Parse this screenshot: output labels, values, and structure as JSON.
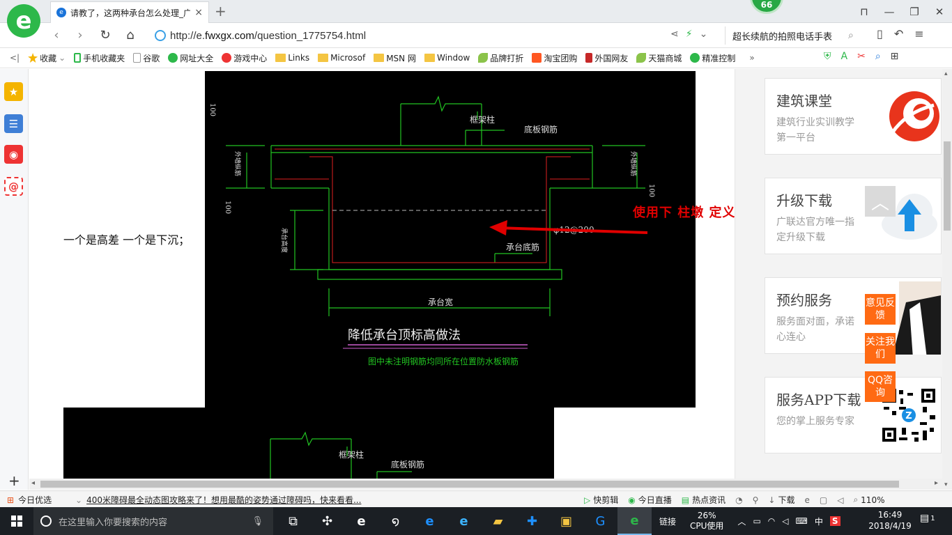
{
  "browser": {
    "tab_title": "请教了，这两种承台怎么处理_广",
    "tab_close": "×",
    "new_tab": "+",
    "badge_count": "66",
    "logo_letter": "e"
  },
  "address": {
    "url_prefix": "http://e.",
    "url_domain": "fwxgx.com",
    "url_suffix": "/question_1775754.html",
    "search_text": "超长续航的拍照电话手表"
  },
  "bookmarks": [
    {
      "label": "收藏",
      "icon": "star-icon",
      "color": "#f4b400"
    },
    {
      "label": "手机收藏夹",
      "icon": "phone-icon",
      "color": "#2db84a"
    },
    {
      "label": "谷歌",
      "icon": "page-icon",
      "color": "#999999"
    },
    {
      "label": "网址大全",
      "icon": "globe-icon",
      "color": "#2db84a"
    },
    {
      "label": "游戏中心",
      "icon": "game-icon",
      "color": "#e33"
    },
    {
      "label": "Links",
      "icon": "folder-icon",
      "color": "#f4c542"
    },
    {
      "label": "Microsof",
      "icon": "folder-icon",
      "color": "#f4c542"
    },
    {
      "label": "MSN 网",
      "icon": "folder-icon",
      "color": "#f4c542"
    },
    {
      "label": "Window",
      "icon": "folder-icon",
      "color": "#f4c542"
    },
    {
      "label": "品牌打折",
      "icon": "leaf-icon",
      "color": "#8bc34a"
    },
    {
      "label": "淘宝团购",
      "icon": "taobao-icon",
      "color": "#ff5722"
    },
    {
      "label": "外国网友",
      "icon": "flag-icon",
      "color": "#c62828"
    },
    {
      "label": "天猫商城",
      "icon": "leaf-icon",
      "color": "#8bc34a"
    },
    {
      "label": "精准控制",
      "icon": "chat-icon",
      "color": "#2db84a"
    }
  ],
  "bookmarks_more": "»",
  "content": {
    "left_caption": "一个是高差 一个是下沉；",
    "red_annotation": "使用下 柱墩 定义",
    "cad": {
      "frame_col_label": "框架柱",
      "bottom_rebar_label": "底板钢筋",
      "pile_cap_bottom_label": "承台底筋",
      "pile_cap_width_label": "承台宽",
      "side_rebar_left": "外墙纵筋",
      "side_rebar_right": "外墙纵筋",
      "height_label": "承台高度",
      "rebar_spec": "φ12@200",
      "dim_100_a": "100",
      "dim_100_b": "100",
      "dim_100_c": "100",
      "drawing_title": "降低承台顶标高做法",
      "drawing_note": "图中未注明钢筋均同所在位置防水板钢筋",
      "frame_col_label_2": "框架柱",
      "bottom_rebar_label_2": "底板钢筋"
    }
  },
  "rightcol": {
    "cards": [
      {
        "title": "建筑课堂",
        "sub": "建筑行业实训教学第一平台",
        "icon": "swirl-logo-icon"
      },
      {
        "title": "升级下载",
        "sub": "广联达官方唯一指定升级下载",
        "icon": "cloud-upload-icon"
      },
      {
        "title": "预约服务",
        "sub": "服务面对面，承诺心连心",
        "icon": "service-person-icon"
      },
      {
        "title": "服务APP下载",
        "sub": "您的掌上服务专家",
        "icon": "qr-code-icon"
      }
    ],
    "float_buttons": [
      "意见反馈",
      "关注我们",
      "QQ咨询"
    ],
    "back_to_top": "︿"
  },
  "status": {
    "today_pick": "今日优选",
    "news": "400米障碍最全动态图攻略来了！想用最酷的姿势通过障碍吗，快来看看...",
    "items": [
      "快剪辑",
      "今日直播",
      "热点资讯",
      "下载"
    ],
    "zoom": "110%"
  },
  "taskbar": {
    "search_placeholder": "在这里输入你要搜索的内容",
    "link_label": "链接",
    "cpu_percent": "26%",
    "cpu_label": "CPU使用",
    "ime": "中",
    "time": "16:49",
    "date": "2018/4/19",
    "notif_count": "1"
  }
}
